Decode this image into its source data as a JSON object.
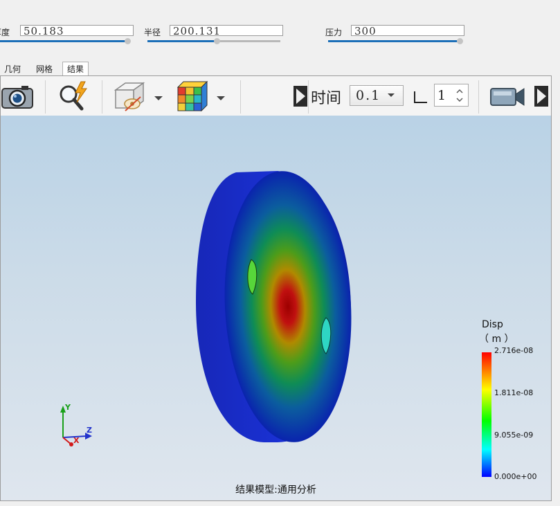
{
  "params": [
    {
      "label": "厚度",
      "value": "50.183",
      "fill": 0.99
    },
    {
      "label": "半径",
      "value": "200.131",
      "fill": 0.5
    },
    {
      "label": "压力",
      "value": "300",
      "fill": 1.0
    }
  ],
  "tabs": [
    {
      "label": "几何",
      "active": false
    },
    {
      "label": "网格",
      "active": false
    },
    {
      "label": "结果",
      "active": true
    }
  ],
  "toolbar": {
    "icons": [
      "camera-icon",
      "search-lightning-icon",
      "cube-visibility-icon",
      "color-cube-icon",
      "play-step-icon",
      "video-camera-icon"
    ],
    "time_label": "时间",
    "time_value": "0.1",
    "step_value": "1"
  },
  "legend": {
    "title_line1": "Disp",
    "title_line2": "（ m ）",
    "ticks": [
      "2.716e-08",
      "1.811e-08",
      "9.055e-09",
      "0.000e+00"
    ],
    "colors": [
      "#ff0000",
      "#ffff00",
      "#00ff00",
      "#00ffff",
      "#0000ff"
    ]
  },
  "axes": {
    "x": "X",
    "y": "Y",
    "z": "Z"
  },
  "caption": "结果模型:通用分析"
}
